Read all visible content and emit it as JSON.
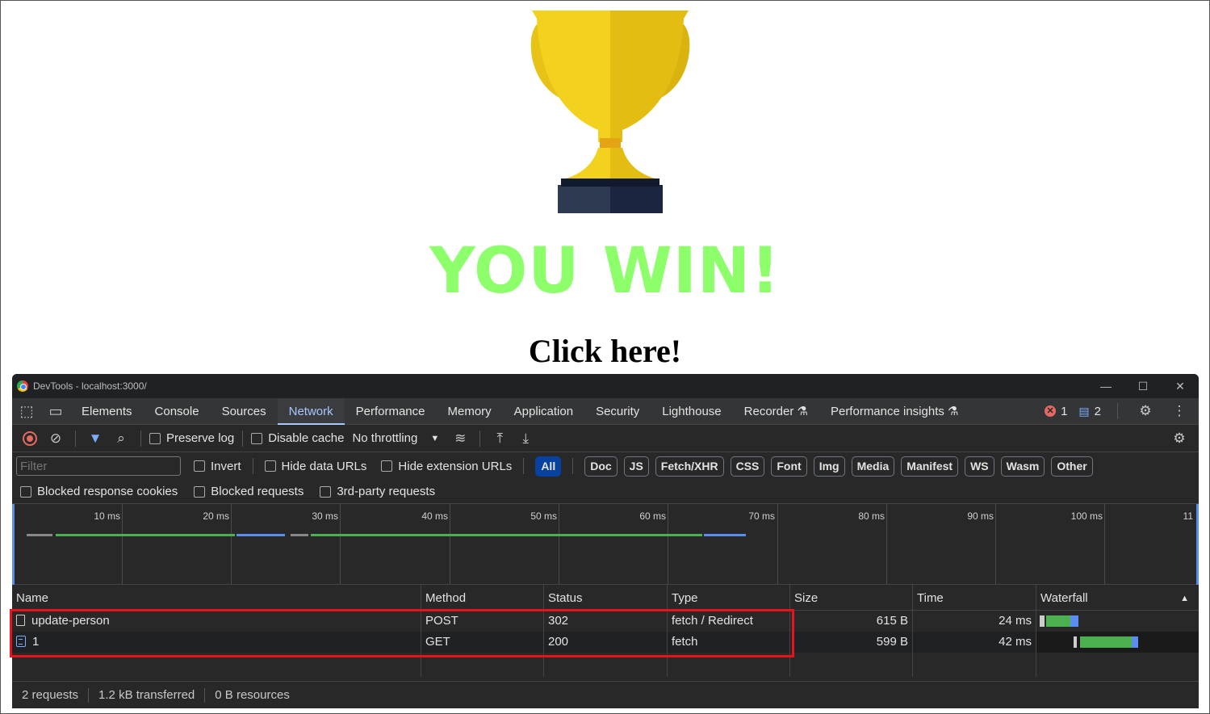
{
  "page": {
    "headline": "YOU WIN!",
    "link_text": "Click here!"
  },
  "devtools": {
    "window_title": "DevTools - localhost:3000/",
    "tabs": [
      {
        "label": "Elements"
      },
      {
        "label": "Console"
      },
      {
        "label": "Sources"
      },
      {
        "label": "Network",
        "active": true
      },
      {
        "label": "Performance"
      },
      {
        "label": "Memory"
      },
      {
        "label": "Application"
      },
      {
        "label": "Security"
      },
      {
        "label": "Lighthouse"
      },
      {
        "label": "Recorder ⚗"
      },
      {
        "label": "Performance insights ⚗"
      }
    ],
    "error_count": "1",
    "message_count": "2",
    "toolbar": {
      "preserve_log": "Preserve log",
      "disable_cache": "Disable cache",
      "throttling": "No throttling"
    },
    "filter": {
      "placeholder": "Filter",
      "invert": "Invert",
      "hide_data_urls": "Hide data URLs",
      "hide_extension_urls": "Hide extension URLs",
      "chips": [
        "All",
        "Doc",
        "JS",
        "Fetch/XHR",
        "CSS",
        "Font",
        "Img",
        "Media",
        "Manifest",
        "WS",
        "Wasm",
        "Other"
      ],
      "active_chip": "All",
      "blocked_response_cookies": "Blocked response cookies",
      "blocked_requests": "Blocked requests",
      "third_party": "3rd-party requests"
    },
    "overview_ticks": [
      "10 ms",
      "20 ms",
      "30 ms",
      "40 ms",
      "50 ms",
      "60 ms",
      "70 ms",
      "80 ms",
      "90 ms",
      "100 ms",
      "11"
    ],
    "columns": {
      "name": "Name",
      "method": "Method",
      "status": "Status",
      "type": "Type",
      "size": "Size",
      "time": "Time",
      "waterfall": "Waterfall"
    },
    "requests": [
      {
        "name": "update-person",
        "method": "POST",
        "status": "302",
        "type": "fetch / Redirect",
        "size": "615 B",
        "time": "24 ms"
      },
      {
        "name": "1",
        "method": "GET",
        "status": "200",
        "type": "fetch",
        "size": "599 B",
        "time": "42 ms"
      }
    ],
    "status_bar": {
      "requests": "2 requests",
      "transferred": "1.2 kB transferred",
      "resources": "0 B resources"
    },
    "colors": {
      "waiting": "#4caf50",
      "download": "#5b8def",
      "highlight": "#e8141c",
      "headline": "#8dff6a"
    }
  }
}
